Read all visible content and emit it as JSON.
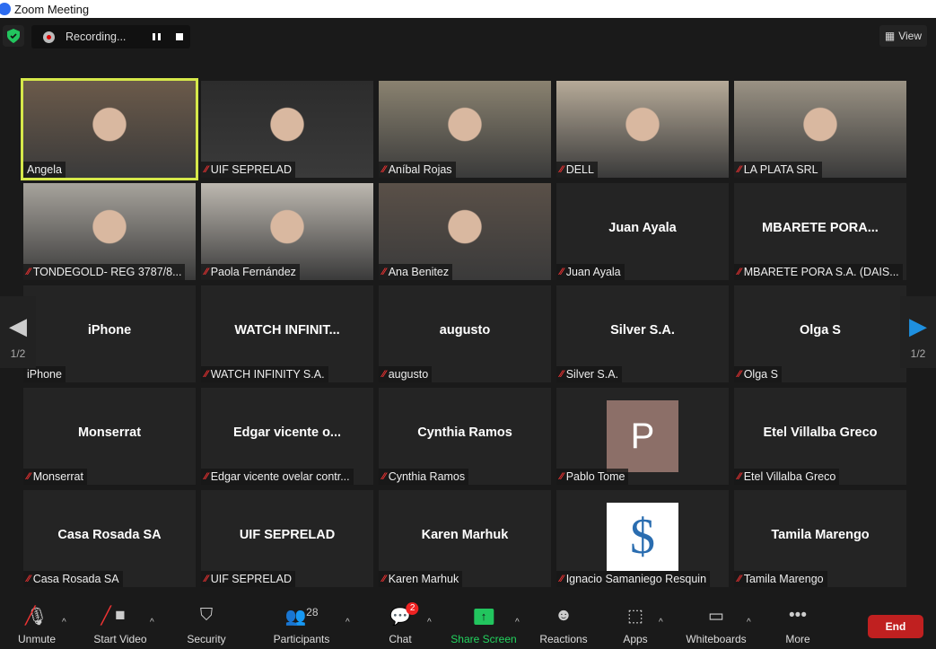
{
  "window": {
    "title": "Zoom Meeting"
  },
  "top": {
    "recording": "Recording...",
    "view": "View"
  },
  "pager": {
    "page": "1/2"
  },
  "tiles": [
    {
      "name": "Angela",
      "video": true,
      "active": true,
      "bg": "#6b5a4a"
    },
    {
      "name": "UIF SEPRELAD",
      "video": true,
      "bg": "#2c2c2c",
      "muted": true
    },
    {
      "name": "Aníbal Rojas",
      "video": true,
      "bg": "#8a8270",
      "muted": true
    },
    {
      "name": "DELL",
      "video": true,
      "bg": "#b6aa98",
      "muted": true
    },
    {
      "name": "LA PLATA SRL",
      "video": true,
      "bg": "#9a9284",
      "muted": true
    },
    {
      "name": "TONDEGOLD- REG 3787/8...",
      "video": true,
      "bg": "#a7a39c",
      "muted": true
    },
    {
      "name": "Paola Fernández",
      "video": true,
      "bg": "#bdb8b0",
      "muted": true
    },
    {
      "name": "Ana Benitez",
      "video": true,
      "bg": "#5a5048",
      "muted": true
    },
    {
      "name": "Juan Ayala",
      "display": "Juan Ayala",
      "muted": true
    },
    {
      "name": "MBARETE PORA S.A. (DAIS...",
      "display": "MBARETE PORA...",
      "muted": true
    },
    {
      "name": "iPhone",
      "display": "iPhone"
    },
    {
      "name": "WATCH INFINITY S.A.",
      "display": "WATCH  INFINIT...",
      "muted": true
    },
    {
      "name": "augusto",
      "display": "augusto",
      "muted": true
    },
    {
      "name": "Silver S.A.",
      "display": "Silver S.A.",
      "muted": true
    },
    {
      "name": "Olga S",
      "display": "Olga S",
      "muted": true
    },
    {
      "name": "Monserrat",
      "display": "Monserrat",
      "muted": true
    },
    {
      "name": "Edgar vicente ovelar contr...",
      "display": "Edgar  vicente  o...",
      "muted": true
    },
    {
      "name": "Cynthia Ramos",
      "display": "Cynthia Ramos",
      "muted": true
    },
    {
      "name": "Pablo Tome",
      "avatar": "P",
      "muted": true
    },
    {
      "name": "Etel Villalba Greco",
      "display": "Etel Villalba Greco",
      "muted": true
    },
    {
      "name": "Casa Rosada SA",
      "display": "Casa Rosada SA",
      "muted": true
    },
    {
      "name": "UIF SEPRELAD",
      "display": "UIF SEPRELAD",
      "muted": true
    },
    {
      "name": "Karen Marhuk",
      "display": "Karen Marhuk",
      "muted": true
    },
    {
      "name": "Ignacio Samaniego Resquin",
      "logo": "$",
      "muted": true
    },
    {
      "name": "Tamila Marengo",
      "display": "Tamila Marengo",
      "muted": true
    }
  ],
  "toolbar": {
    "unmute": "Unmute",
    "start_video": "Start Video",
    "security": "Security",
    "participants": "Participants",
    "participants_count": "28",
    "chat": "Chat",
    "chat_badge": "2",
    "share": "Share Screen",
    "reactions": "Reactions",
    "apps": "Apps",
    "whiteboards": "Whiteboards",
    "more": "More",
    "end": "End"
  },
  "colors": {
    "active_speaker": "#d6e84a",
    "share": "#22c55e",
    "end": "#c02020"
  }
}
